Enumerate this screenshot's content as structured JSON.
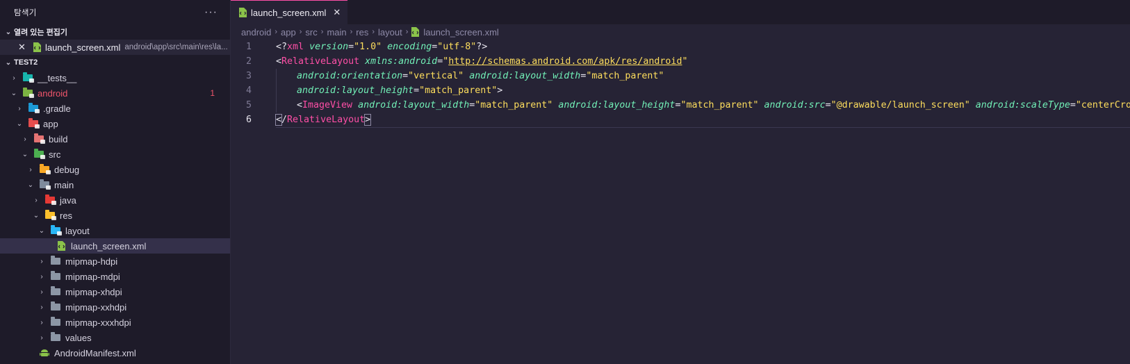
{
  "sidebar": {
    "title": "탐색기",
    "more_label": "···",
    "open_editors": {
      "section_label": "열려 있는 편집기",
      "items": [
        {
          "close": "✕",
          "name": "launch_screen.xml",
          "path": "android\\app\\src\\main\\res\\la..."
        }
      ]
    },
    "workspace": {
      "section_label": "TEST2",
      "tree": [
        {
          "label": "__tests__",
          "twisty": "›",
          "icon": "folder-tests-icon",
          "color": "#17b5ad"
        },
        {
          "label": "android",
          "twisty": "⌄",
          "icon": "folder-android-icon",
          "color": "#7cb342",
          "badge": "1",
          "error": true
        },
        {
          "label": ".gradle",
          "twisty": "›",
          "icon": "folder-gradle-icon",
          "color": "#1c9ad6"
        },
        {
          "label": "app",
          "twisty": "⌄",
          "icon": "folder-app-icon",
          "color": "#e54d4d"
        },
        {
          "label": "build",
          "twisty": "›",
          "icon": "folder-build-icon",
          "color": "#e57373"
        },
        {
          "label": "src",
          "twisty": "⌄",
          "icon": "folder-src-icon",
          "color": "#4caf50"
        },
        {
          "label": "debug",
          "twisty": "›",
          "icon": "folder-debug-icon",
          "color": "#f9a825"
        },
        {
          "label": "main",
          "twisty": "⌄",
          "icon": "folder-main-icon",
          "color": "#7e8b9c"
        },
        {
          "label": "java",
          "twisty": "›",
          "icon": "folder-java-icon",
          "color": "#e53935"
        },
        {
          "label": "res",
          "twisty": "⌄",
          "icon": "folder-res-icon",
          "color": "#fbc02d"
        },
        {
          "label": "layout",
          "twisty": "⌄",
          "icon": "folder-layout-icon",
          "color": "#29b6f6"
        },
        {
          "label": "launch_screen.xml",
          "twisty": "",
          "icon": "xml-file-icon",
          "color": "#8bc34a",
          "selected": true
        },
        {
          "label": "mipmap-hdpi",
          "twisty": "›",
          "icon": "folder-icon",
          "color": "#8c96a5"
        },
        {
          "label": "mipmap-mdpi",
          "twisty": "›",
          "icon": "folder-icon",
          "color": "#8c96a5"
        },
        {
          "label": "mipmap-xhdpi",
          "twisty": "›",
          "icon": "folder-icon",
          "color": "#8c96a5"
        },
        {
          "label": "mipmap-xxhdpi",
          "twisty": "›",
          "icon": "folder-icon",
          "color": "#8c96a5"
        },
        {
          "label": "mipmap-xxxhdpi",
          "twisty": "›",
          "icon": "folder-icon",
          "color": "#8c96a5"
        },
        {
          "label": "values",
          "twisty": "›",
          "icon": "folder-icon",
          "color": "#8c96a5"
        },
        {
          "label": "AndroidManifest.xml",
          "twisty": "",
          "icon": "android-icon",
          "color": "#8bc34a"
        }
      ]
    }
  },
  "editor": {
    "tab": {
      "label": "launch_screen.xml",
      "close": "✕"
    },
    "breadcrumb": [
      "android",
      "app",
      "src",
      "main",
      "res",
      "layout",
      "launch_screen.xml"
    ],
    "lines": [
      {
        "n": "1",
        "tokens": [
          [
            "p",
            "<?"
          ],
          [
            "tag",
            "xml"
          ],
          [
            "p",
            " "
          ],
          [
            "attr",
            "version"
          ],
          [
            "p",
            "="
          ],
          [
            "str",
            "\"1.0\""
          ],
          [
            "p",
            " "
          ],
          [
            "attr",
            "encoding"
          ],
          [
            "p",
            "="
          ],
          [
            "str",
            "\"utf-8\""
          ],
          [
            "p",
            "?>"
          ]
        ]
      },
      {
        "n": "2",
        "tokens": [
          [
            "p",
            "<"
          ],
          [
            "tag",
            "RelativeLayout"
          ],
          [
            "p",
            " "
          ],
          [
            "attr",
            "xmlns:android"
          ],
          [
            "p",
            "="
          ],
          [
            "str",
            "\""
          ],
          [
            "url",
            "http://schemas.android.com/apk/res/android"
          ],
          [
            "str",
            "\""
          ]
        ]
      },
      {
        "n": "3",
        "indent": 1,
        "tokens": [
          [
            "attr",
            "android:orientation"
          ],
          [
            "p",
            "="
          ],
          [
            "str",
            "\"vertical\""
          ],
          [
            "p",
            " "
          ],
          [
            "attr",
            "android:layout_width"
          ],
          [
            "p",
            "="
          ],
          [
            "str",
            "\"match_parent\""
          ]
        ]
      },
      {
        "n": "4",
        "indent": 1,
        "tokens": [
          [
            "attr",
            "android:layout_height"
          ],
          [
            "p",
            "="
          ],
          [
            "str",
            "\"match_parent\""
          ],
          [
            "p",
            ">"
          ]
        ]
      },
      {
        "n": "5",
        "indent": 1,
        "tokens": [
          [
            "p",
            "<"
          ],
          [
            "tag",
            "ImageView"
          ],
          [
            "p",
            " "
          ],
          [
            "attr",
            "android:layout_width"
          ],
          [
            "p",
            "="
          ],
          [
            "str",
            "\"match_parent\""
          ],
          [
            "p",
            " "
          ],
          [
            "attr",
            "android:layout_height"
          ],
          [
            "p",
            "="
          ],
          [
            "str",
            "\"match_parent\""
          ],
          [
            "p",
            " "
          ],
          [
            "attr",
            "android:src"
          ],
          [
            "p",
            "="
          ],
          [
            "str",
            "\"@drawable/launch_screen\""
          ],
          [
            "p",
            " "
          ],
          [
            "attr",
            "android:scaleType"
          ],
          [
            "p",
            "="
          ],
          [
            "str",
            "\"centerCrop\""
          ],
          [
            "p",
            " />"
          ]
        ]
      },
      {
        "n": "6",
        "current": true,
        "tokens": [
          [
            "bracket",
            "<"
          ],
          [
            "p",
            "/"
          ],
          [
            "tag",
            "RelativeLayout"
          ],
          [
            "bracket",
            ">"
          ]
        ]
      }
    ]
  }
}
